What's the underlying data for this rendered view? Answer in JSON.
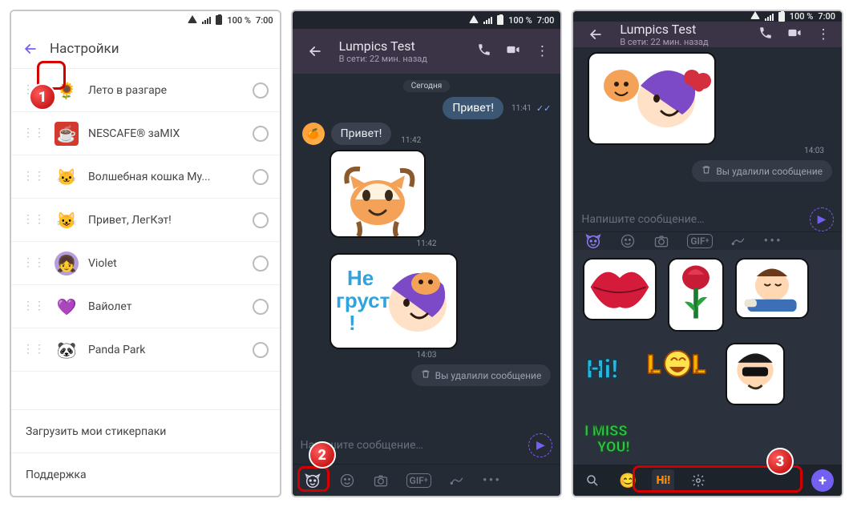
{
  "status": {
    "pct": "100 %",
    "time": "7:00"
  },
  "screen1": {
    "title": "Настройки",
    "packs": [
      {
        "name": "Лето в разгаре"
      },
      {
        "name": "NESCAFE® заMIX"
      },
      {
        "name": "Волшебная кошка Му..."
      },
      {
        "name": "Привет, ЛегКэт!"
      },
      {
        "name": "Violet"
      },
      {
        "name": "Вайолет"
      },
      {
        "name": "Panda Park"
      }
    ],
    "download": "Загрузить мои стикерпаки",
    "support": "Поддержка"
  },
  "chat": {
    "title": "Lumpics Test",
    "subtitle": "В сети: 22 мин. назад",
    "today": "Сегодня",
    "out_msg": "Привет!",
    "out_time": "11:41",
    "in_msg": "Привет!",
    "in_time": "11:42",
    "sticker_time1": "11:42",
    "sticker_time2": "14:03",
    "sticker_text": "Не грусти !",
    "deleted": "Вы удалили сообщение",
    "input_ph": "Напишите сообщение…"
  },
  "callouts": {
    "n1": "1",
    "n2": "2",
    "n3": "3"
  }
}
